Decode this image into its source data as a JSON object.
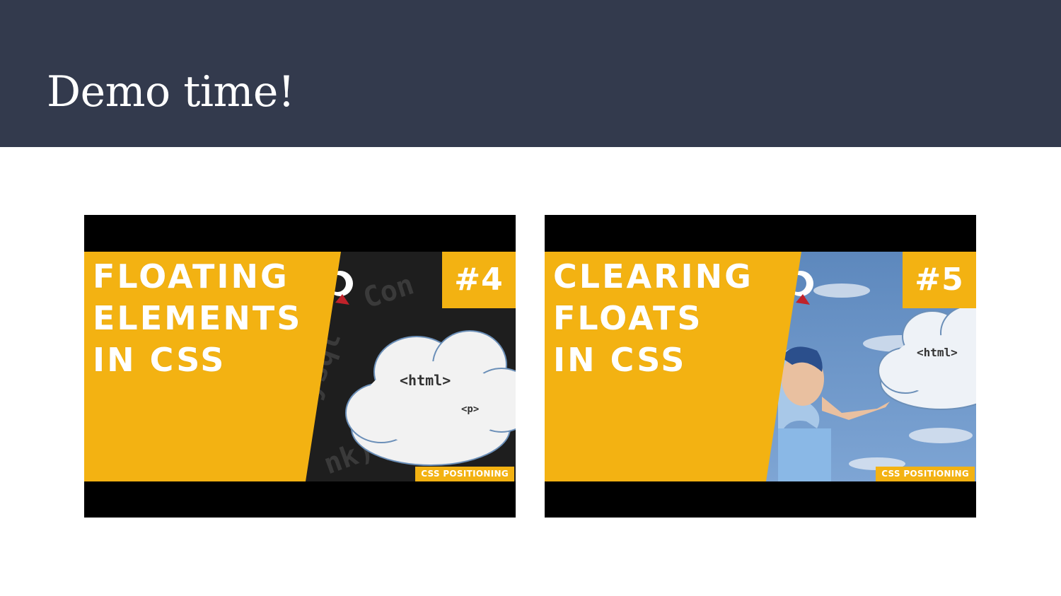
{
  "slide": {
    "title": "Demo time!"
  },
  "colors": {
    "header_bg": "#333a4d",
    "accent_yellow": "#f3b212",
    "page_bg": "#ffffff"
  },
  "videos": [
    {
      "title_lines": [
        "FLOATING",
        "ELEMENTS",
        "IN CSS"
      ],
      "episode": "#4",
      "series": "CSS POSITIONING",
      "cloud_tags": [
        "<html>",
        "<p>"
      ],
      "background": "dark-code-screen"
    },
    {
      "title_lines": [
        "CLEARING",
        "FLOATS",
        "IN CSS"
      ],
      "episode": "#5",
      "series": "CSS POSITIONING",
      "cloud_tags": [
        "<html>"
      ],
      "background": "blue-sky-person-blowing"
    }
  ]
}
